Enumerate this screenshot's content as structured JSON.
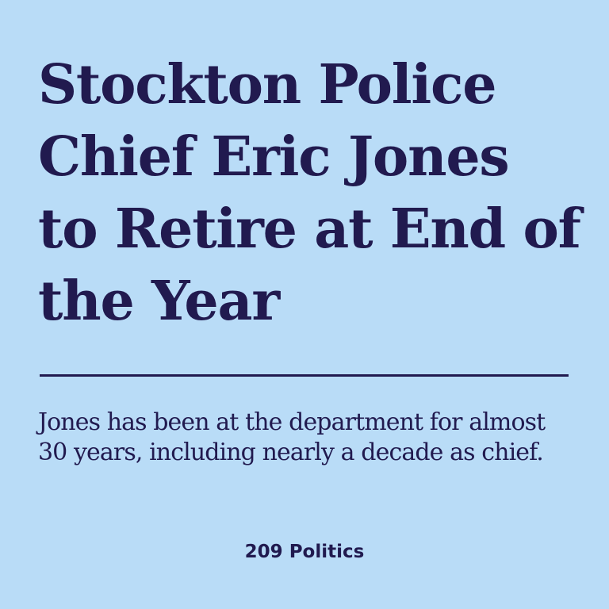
{
  "article": {
    "headline": "Stockton Police Chief Eric Jones to Retire at End of the Year",
    "summary": "Jones has been at the department for almost 30 years, including nearly a decade as chief.",
    "source": "209 Politics"
  },
  "colors": {
    "background": "#b9dcf7",
    "text": "#211a4f"
  }
}
